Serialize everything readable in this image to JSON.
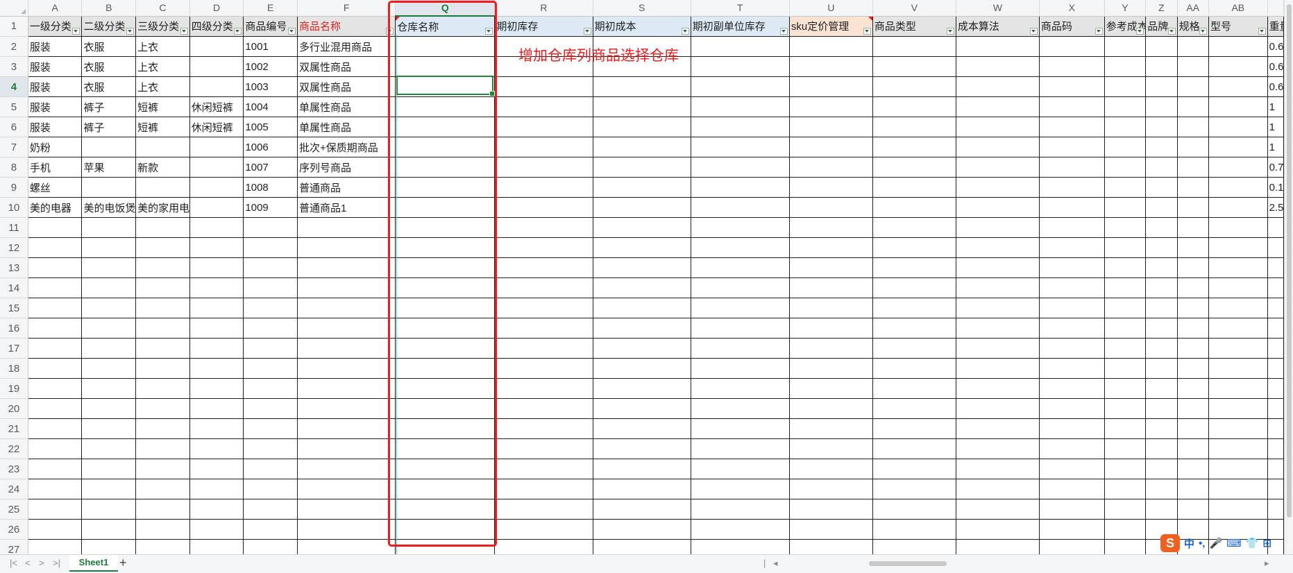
{
  "columns": [
    {
      "letter": "",
      "w": 40
    },
    {
      "letter": "A",
      "w": 77
    },
    {
      "letter": "B",
      "w": 77
    },
    {
      "letter": "C",
      "w": 77
    },
    {
      "letter": "D",
      "w": 77
    },
    {
      "letter": "E",
      "w": 77
    },
    {
      "letter": "F",
      "w": 140
    },
    {
      "letter": "Q",
      "w": 142
    },
    {
      "letter": "R",
      "w": 140
    },
    {
      "letter": "S",
      "w": 140
    },
    {
      "letter": "T",
      "w": 141
    },
    {
      "letter": "U",
      "w": 119
    },
    {
      "letter": "V",
      "w": 119
    },
    {
      "letter": "W",
      "w": 119
    },
    {
      "letter": "X",
      "w": 93
    },
    {
      "letter": "Y",
      "w": 59
    },
    {
      "letter": "Z",
      "w": 45
    },
    {
      "letter": "AA",
      "w": 45
    },
    {
      "letter": "AB",
      "w": 84
    },
    {
      "letter": "",
      "w": 23
    }
  ],
  "header_row": {
    "cells": [
      {
        "text": "一级分类",
        "filter": true
      },
      {
        "text": "二级分类",
        "filter": true
      },
      {
        "text": "三级分类",
        "filter": true
      },
      {
        "text": "四级分类",
        "filter": true
      },
      {
        "text": "商品编号",
        "filter": true
      },
      {
        "text": "商品名称",
        "filter": true,
        "red": true
      },
      {
        "text": "仓库名称",
        "filter": true,
        "blue": true,
        "redmark_left": true
      },
      {
        "text": "期初库存",
        "filter": true,
        "blue": true
      },
      {
        "text": "期初成本",
        "filter": true,
        "blue": true
      },
      {
        "text": "期初副单位库存",
        "filter": true,
        "blue": true
      },
      {
        "text": "sku定价管理",
        "filter": true,
        "orange": true,
        "redmark": true
      },
      {
        "text": "商品类型",
        "filter": true
      },
      {
        "text": "成本算法",
        "filter": true
      },
      {
        "text": "商品码",
        "filter": true
      },
      {
        "text": "参考成本",
        "filter": true
      },
      {
        "text": "品牌",
        "filter": true
      },
      {
        "text": "规格",
        "filter": true
      },
      {
        "text": "型号",
        "filter": true
      },
      {
        "text": "重量",
        "filter": false
      }
    ]
  },
  "rows": [
    [
      "服装",
      "衣服",
      "上衣",
      "",
      "1001",
      "多行业混用商品",
      "",
      "",
      "",
      "",
      "",
      "",
      "",
      "",
      "",
      "",
      "",
      "",
      "0.6"
    ],
    [
      "服装",
      "衣服",
      "上衣",
      "",
      "1002",
      "双属性商品",
      "",
      "",
      "",
      "",
      "",
      "",
      "",
      "",
      "",
      "",
      "",
      "",
      "0.6"
    ],
    [
      "服装",
      "衣服",
      "上衣",
      "",
      "1003",
      "双属性商品",
      "",
      "",
      "",
      "",
      "",
      "",
      "",
      "",
      "",
      "",
      "",
      "",
      "0.6"
    ],
    [
      "服装",
      "裤子",
      "短裤",
      "休闲短裤",
      "1004",
      "单属性商品",
      "",
      "",
      "",
      "",
      "",
      "",
      "",
      "",
      "",
      "",
      "",
      "",
      "1"
    ],
    [
      "服装",
      "裤子",
      "短裤",
      "休闲短裤",
      "1005",
      "单属性商品",
      "",
      "",
      "",
      "",
      "",
      "",
      "",
      "",
      "",
      "",
      "",
      "",
      "1"
    ],
    [
      "奶粉",
      "",
      "",
      "",
      "1006",
      "批次+保质期商品",
      "",
      "",
      "",
      "",
      "",
      "",
      "",
      "",
      "",
      "",
      "",
      "",
      "1"
    ],
    [
      "手机",
      "苹果",
      "新款",
      "",
      "1007",
      "序列号商品",
      "",
      "",
      "",
      "",
      "",
      "",
      "",
      "",
      "",
      "",
      "",
      "",
      "0.7"
    ],
    [
      "螺丝",
      "",
      "",
      "",
      "1008",
      "普通商品",
      "",
      "",
      "",
      "",
      "",
      "",
      "",
      "",
      "",
      "",
      "",
      "",
      "0.1"
    ],
    [
      "美的电器",
      "美的电饭煲",
      "美的家用电饭煲",
      "",
      "1009",
      "普通商品1",
      "",
      "",
      "",
      "",
      "",
      "",
      "",
      "",
      "",
      "",
      "",
      "",
      "2.5"
    ]
  ],
  "total_rows": 27,
  "active_row": 4,
  "selected_column": "Q",
  "annotation": "增加仓库列商品选择仓库",
  "sheet_tab": "Sheet1",
  "add_sheet": "+",
  "nav": [
    "|<",
    "<",
    ">",
    ">|"
  ],
  "ime": {
    "logo": "S",
    "items": [
      "中",
      "•,",
      "🎤",
      "⌨",
      "👕",
      "⊞"
    ]
  },
  "colors": {
    "accent": "#1a7a3a",
    "annotation_red": "#ee1c1c"
  }
}
